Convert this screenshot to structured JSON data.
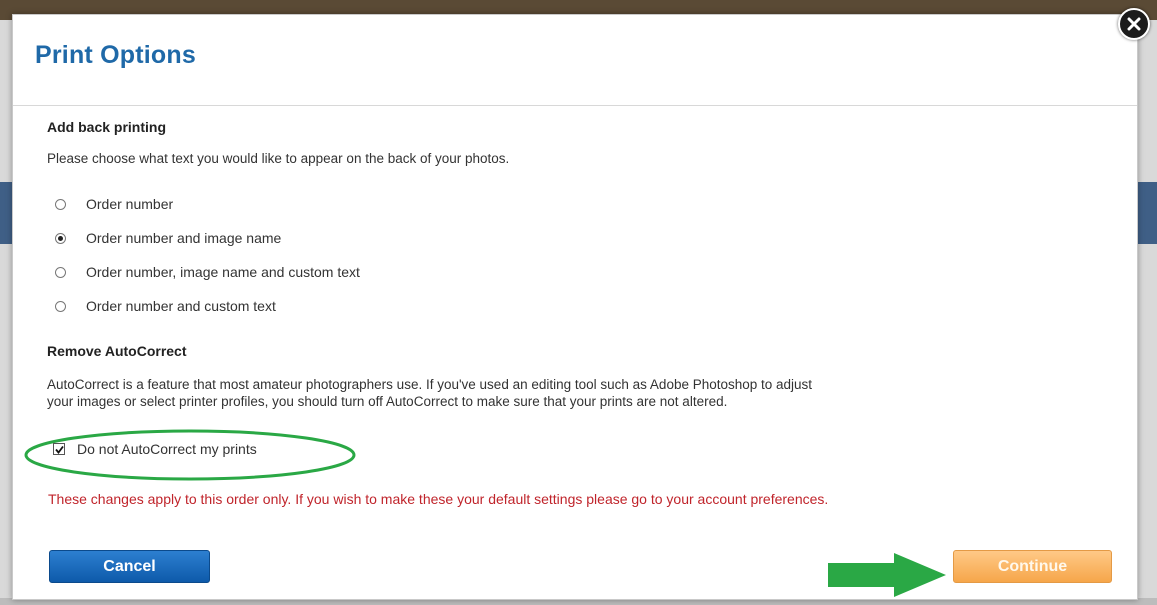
{
  "dialog": {
    "title": "Print Options"
  },
  "back_printing": {
    "heading": "Add back printing",
    "description": "Please choose what text you would like to appear on the back of your photos.",
    "options": [
      {
        "label": "Order number",
        "checked": false
      },
      {
        "label": "Order number and image name",
        "checked": true
      },
      {
        "label": "Order number, image name and custom text",
        "checked": false
      },
      {
        "label": "Order number and custom text",
        "checked": false
      }
    ]
  },
  "autocorrect": {
    "heading": "Remove AutoCorrect",
    "description_line1": "AutoCorrect is a feature that most amateur photographers use. If you've used an editing tool such as Adobe Photoshop to adjust",
    "description_line2": "your images or select printer profiles, you should turn off AutoCorrect to make sure that your prints are not altered.",
    "checkbox_label": "Do not AutoCorrect my prints",
    "checkbox_checked": true
  },
  "notice": "These changes apply to this order only. If you wish to make these your default settings please go to your account preferences.",
  "buttons": {
    "cancel": "Cancel",
    "continue": "Continue"
  },
  "icons": {
    "close": "close-icon",
    "arrow": "green-arrow-icon"
  },
  "colors": {
    "title": "#1f69a8",
    "notice": "#c0242b",
    "cancel_button": "#1466bd",
    "continue_button": "#f8b265",
    "annotation_green": "#2aa845"
  }
}
